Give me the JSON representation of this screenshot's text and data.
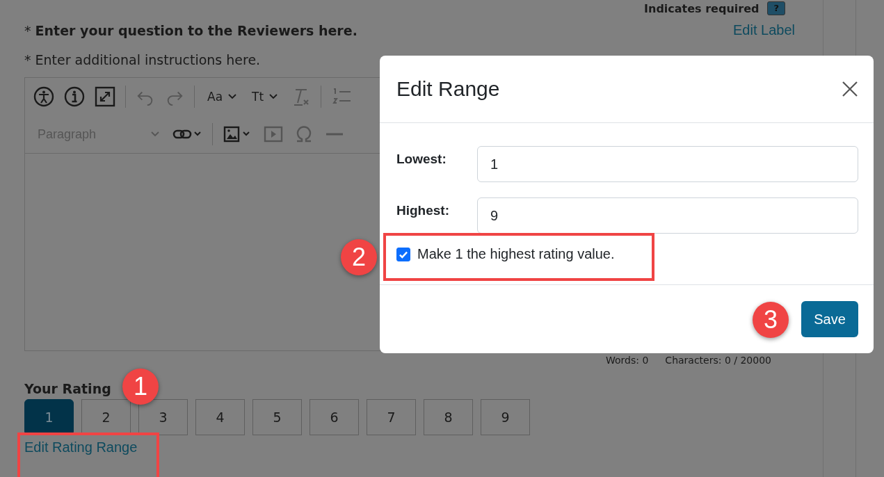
{
  "required_note": {
    "text": "Indicates required",
    "help_badge": "?"
  },
  "question": {
    "label": "* **Enter your question to the Reviewers here.**",
    "edit_link": "Edit Label"
  },
  "instructions": {
    "label": "* Enter additional instructions here."
  },
  "editor": {
    "font_family_button": "Aa",
    "font_size_button": "Tt",
    "paragraph_style": "Paragraph",
    "word_count": "Words: 0",
    "character_count": "Characters: 0 / 20000"
  },
  "rating": {
    "label": "Your Rating",
    "edit_link": "Edit Rating Range",
    "options": [
      {
        "label": "1",
        "selected": true
      },
      {
        "label": "2",
        "selected": false
      },
      {
        "label": "3",
        "selected": false
      },
      {
        "label": "4",
        "selected": false
      },
      {
        "label": "5",
        "selected": false
      },
      {
        "label": "6",
        "selected": false
      },
      {
        "label": "7",
        "selected": false
      },
      {
        "label": "8",
        "selected": false
      },
      {
        "label": "9",
        "selected": false
      }
    ]
  },
  "modal": {
    "title": "Edit Range",
    "fields": [
      {
        "label": "Lowest:",
        "value": "1"
      },
      {
        "label": "Highest:",
        "value": "9"
      }
    ],
    "checkbox": {
      "label": "Make 1 the highest rating value.",
      "checked": true
    },
    "save_button": "Save"
  },
  "callouts": [
    {
      "number": "1"
    },
    {
      "number": "2"
    },
    {
      "number": "3"
    }
  ]
}
